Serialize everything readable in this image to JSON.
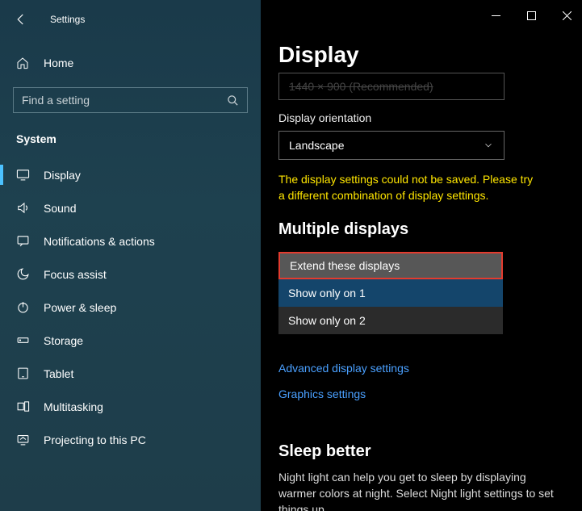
{
  "titlebar": {
    "title": "Settings"
  },
  "home": {
    "label": "Home"
  },
  "search": {
    "placeholder": "Find a setting"
  },
  "section": {
    "label": "System"
  },
  "nav": {
    "items": [
      {
        "label": "Display"
      },
      {
        "label": "Sound"
      },
      {
        "label": "Notifications & actions"
      },
      {
        "label": "Focus assist"
      },
      {
        "label": "Power & sleep"
      },
      {
        "label": "Storage"
      },
      {
        "label": "Tablet"
      },
      {
        "label": "Multitasking"
      },
      {
        "label": "Projecting to this PC"
      }
    ]
  },
  "main": {
    "page_title": "Display",
    "resolution_cutoff": "1440 × 900 (Recommended)",
    "orientation_label": "Display orientation",
    "orientation_value": "Landscape",
    "error": "The display settings could not be saved. Please try a different combination of display settings.",
    "multi_h": "Multiple displays",
    "dd": {
      "items": [
        "Extend these displays",
        "Show only on 1",
        "Show only on 2"
      ]
    },
    "adv_link": "Advanced display settings",
    "gfx_link": "Graphics settings",
    "sleep_h": "Sleep better",
    "sleep_p": "Night light can help you get to sleep by displaying warmer colors at night. Select Night light settings to set things up."
  }
}
